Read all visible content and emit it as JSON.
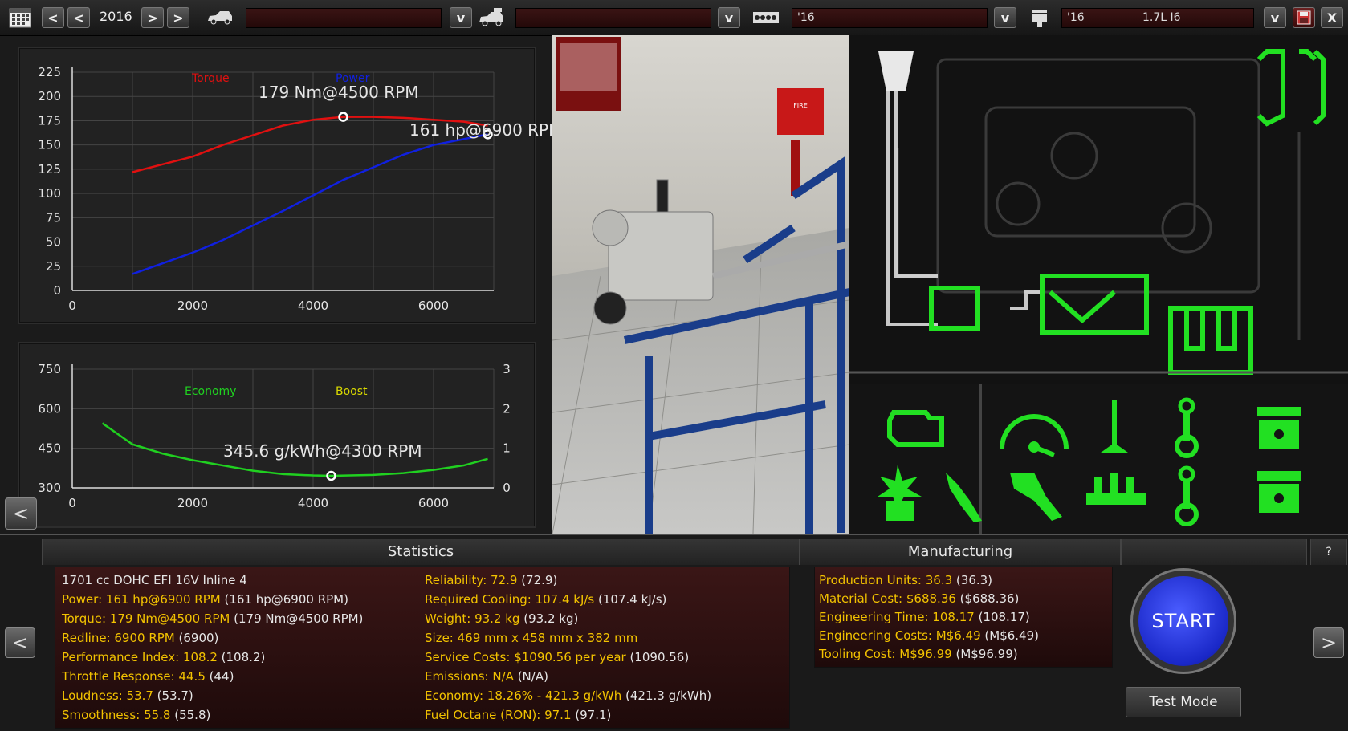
{
  "topbar": {
    "year": "2016",
    "engine_family_field": "'16",
    "variant_field_year": "'16",
    "variant_field_name": "1.7L I6",
    "dropdown_glyph": "v",
    "prev_glyph": "<",
    "next_glyph": ">",
    "close_glyph": "X"
  },
  "power_chart": {
    "torque_label": "Torque",
    "power_label": "Power",
    "torque_peak": "179 Nm@4500 RPM",
    "power_peak": "161 hp@6900 RPM",
    "y_ticks": [
      "225",
      "200",
      "175",
      "150",
      "125",
      "100",
      "75",
      "50",
      "25",
      "0"
    ],
    "x_ticks": [
      "0",
      "2000",
      "4000",
      "6000"
    ],
    "colors": {
      "torque": "#e01010",
      "power": "#1020e0"
    }
  },
  "chart_data": [
    {
      "type": "line",
      "x": [
        1000,
        1500,
        2000,
        2500,
        3000,
        3500,
        4000,
        4500,
        5000,
        5500,
        6000,
        6500,
        6900
      ],
      "series": [
        {
          "name": "Torque",
          "values": [
            122,
            130,
            138,
            150,
            160,
            170,
            176,
            179,
            179,
            178,
            176,
            174,
            170
          ]
        },
        {
          "name": "Power",
          "values": [
            17,
            28,
            39,
            52,
            67,
            82,
            98,
            114,
            127,
            140,
            150,
            156,
            161
          ]
        }
      ],
      "ylim": [
        0,
        225
      ],
      "xlim": [
        0,
        7000
      ],
      "grid": true
    },
    {
      "type": "line",
      "x": [
        500,
        1000,
        1500,
        2000,
        2500,
        3000,
        3500,
        4000,
        4300,
        5000,
        5500,
        6000,
        6500,
        6900
      ],
      "series": [
        {
          "name": "Economy",
          "values": [
            545,
            465,
            430,
            405,
            385,
            365,
            352,
            347,
            345.6,
            349,
            356,
            368,
            385,
            410
          ]
        }
      ],
      "ylim": [
        300,
        750
      ],
      "xlim": [
        0,
        7000
      ],
      "y2lim": [
        0,
        3
      ],
      "grid": true
    }
  ],
  "econ_chart": {
    "economy_label": "Economy",
    "boost_label": "Boost",
    "economy_peak": "345.6 g/kWh@4300 RPM",
    "y_ticks": [
      "750",
      "600",
      "450",
      "300"
    ],
    "y2_ticks": [
      "3",
      "2",
      "1",
      "0"
    ],
    "x_ticks": [
      "0",
      "2000",
      "4000",
      "6000"
    ],
    "colors": {
      "economy": "#20d020",
      "boost": "#d8d800"
    }
  },
  "stats": {
    "title": "Statistics",
    "left": [
      {
        "k": "1701 cc DOHC EFI 16V Inline 4",
        "v": ""
      },
      {
        "k": "Power: 161 hp@6900 RPM",
        "v": " (161 hp@6900 RPM)"
      },
      {
        "k": "Torque: 179 Nm@4500 RPM",
        "v": " (179 Nm@4500 RPM)"
      },
      {
        "k": "Redline: 6900 RPM",
        "v": " (6900)"
      },
      {
        "k": "Performance Index: 108.2",
        "v": " (108.2)"
      },
      {
        "k": "Throttle Response: 44.5",
        "v": " (44)"
      },
      {
        "k": "Loudness: 53.7",
        "v": " (53.7)"
      },
      {
        "k": "Smoothness: 55.8",
        "v": " (55.8)"
      }
    ],
    "right": [
      {
        "k": "Reliability: 72.9",
        "v": " (72.9)"
      },
      {
        "k": "Required Cooling: 107.4 kJ/s",
        "v": " (107.4 kJ/s)"
      },
      {
        "k": "Weight: 93.2 kg",
        "v": " (93.2 kg)"
      },
      {
        "k": "Size: 469 mm x 458 mm x 382 mm",
        "v": ""
      },
      {
        "k": "Service Costs: $1090.56 per year",
        "v": " (1090.56)"
      },
      {
        "k": "Emissions: N/A",
        "v": " (N/A)"
      },
      {
        "k": "Economy: 18.26% - 421.3 g/kWh",
        "v": " (421.3 g/kWh)"
      },
      {
        "k": "Fuel Octane (RON): 97.1",
        "v": " (97.1)"
      }
    ]
  },
  "manufacturing": {
    "title": "Manufacturing",
    "lines": [
      {
        "k": "Production Units: 36.3",
        "v": " (36.3)"
      },
      {
        "k": "Material Cost: $688.36",
        "v": " ($688.36)"
      },
      {
        "k": "Engineering Time: 108.17",
        "v": " (108.17)"
      },
      {
        "k": "Engineering Costs: M$6.49",
        "v": " (M$6.49)"
      },
      {
        "k": "Tooling Cost: M$96.99",
        "v": " (M$96.99)"
      }
    ]
  },
  "controls": {
    "start_label": "START",
    "test_mode_label": "Test Mode",
    "help_label": "?",
    "back_glyph": "<",
    "forward_glyph": ">"
  }
}
